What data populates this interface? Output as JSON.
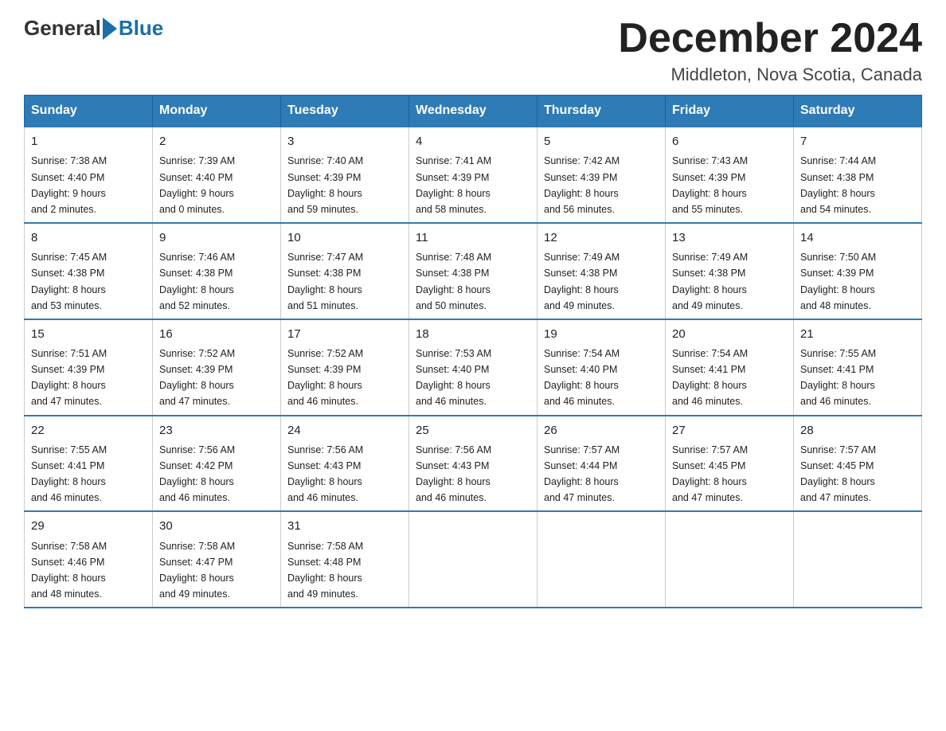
{
  "logo": {
    "general": "General",
    "blue": "Blue"
  },
  "title": "December 2024",
  "location": "Middleton, Nova Scotia, Canada",
  "days_of_week": [
    "Sunday",
    "Monday",
    "Tuesday",
    "Wednesday",
    "Thursday",
    "Friday",
    "Saturday"
  ],
  "weeks": [
    [
      {
        "day": "1",
        "sunrise": "7:38 AM",
        "sunset": "4:40 PM",
        "daylight": "9 hours and 2 minutes."
      },
      {
        "day": "2",
        "sunrise": "7:39 AM",
        "sunset": "4:40 PM",
        "daylight": "9 hours and 0 minutes."
      },
      {
        "day": "3",
        "sunrise": "7:40 AM",
        "sunset": "4:39 PM",
        "daylight": "8 hours and 59 minutes."
      },
      {
        "day": "4",
        "sunrise": "7:41 AM",
        "sunset": "4:39 PM",
        "daylight": "8 hours and 58 minutes."
      },
      {
        "day": "5",
        "sunrise": "7:42 AM",
        "sunset": "4:39 PM",
        "daylight": "8 hours and 56 minutes."
      },
      {
        "day": "6",
        "sunrise": "7:43 AM",
        "sunset": "4:39 PM",
        "daylight": "8 hours and 55 minutes."
      },
      {
        "day": "7",
        "sunrise": "7:44 AM",
        "sunset": "4:38 PM",
        "daylight": "8 hours and 54 minutes."
      }
    ],
    [
      {
        "day": "8",
        "sunrise": "7:45 AM",
        "sunset": "4:38 PM",
        "daylight": "8 hours and 53 minutes."
      },
      {
        "day": "9",
        "sunrise": "7:46 AM",
        "sunset": "4:38 PM",
        "daylight": "8 hours and 52 minutes."
      },
      {
        "day": "10",
        "sunrise": "7:47 AM",
        "sunset": "4:38 PM",
        "daylight": "8 hours and 51 minutes."
      },
      {
        "day": "11",
        "sunrise": "7:48 AM",
        "sunset": "4:38 PM",
        "daylight": "8 hours and 50 minutes."
      },
      {
        "day": "12",
        "sunrise": "7:49 AM",
        "sunset": "4:38 PM",
        "daylight": "8 hours and 49 minutes."
      },
      {
        "day": "13",
        "sunrise": "7:49 AM",
        "sunset": "4:38 PM",
        "daylight": "8 hours and 49 minutes."
      },
      {
        "day": "14",
        "sunrise": "7:50 AM",
        "sunset": "4:39 PM",
        "daylight": "8 hours and 48 minutes."
      }
    ],
    [
      {
        "day": "15",
        "sunrise": "7:51 AM",
        "sunset": "4:39 PM",
        "daylight": "8 hours and 47 minutes."
      },
      {
        "day": "16",
        "sunrise": "7:52 AM",
        "sunset": "4:39 PM",
        "daylight": "8 hours and 47 minutes."
      },
      {
        "day": "17",
        "sunrise": "7:52 AM",
        "sunset": "4:39 PM",
        "daylight": "8 hours and 46 minutes."
      },
      {
        "day": "18",
        "sunrise": "7:53 AM",
        "sunset": "4:40 PM",
        "daylight": "8 hours and 46 minutes."
      },
      {
        "day": "19",
        "sunrise": "7:54 AM",
        "sunset": "4:40 PM",
        "daylight": "8 hours and 46 minutes."
      },
      {
        "day": "20",
        "sunrise": "7:54 AM",
        "sunset": "4:41 PM",
        "daylight": "8 hours and 46 minutes."
      },
      {
        "day": "21",
        "sunrise": "7:55 AM",
        "sunset": "4:41 PM",
        "daylight": "8 hours and 46 minutes."
      }
    ],
    [
      {
        "day": "22",
        "sunrise": "7:55 AM",
        "sunset": "4:41 PM",
        "daylight": "8 hours and 46 minutes."
      },
      {
        "day": "23",
        "sunrise": "7:56 AM",
        "sunset": "4:42 PM",
        "daylight": "8 hours and 46 minutes."
      },
      {
        "day": "24",
        "sunrise": "7:56 AM",
        "sunset": "4:43 PM",
        "daylight": "8 hours and 46 minutes."
      },
      {
        "day": "25",
        "sunrise": "7:56 AM",
        "sunset": "4:43 PM",
        "daylight": "8 hours and 46 minutes."
      },
      {
        "day": "26",
        "sunrise": "7:57 AM",
        "sunset": "4:44 PM",
        "daylight": "8 hours and 47 minutes."
      },
      {
        "day": "27",
        "sunrise": "7:57 AM",
        "sunset": "4:45 PM",
        "daylight": "8 hours and 47 minutes."
      },
      {
        "day": "28",
        "sunrise": "7:57 AM",
        "sunset": "4:45 PM",
        "daylight": "8 hours and 47 minutes."
      }
    ],
    [
      {
        "day": "29",
        "sunrise": "7:58 AM",
        "sunset": "4:46 PM",
        "daylight": "8 hours and 48 minutes."
      },
      {
        "day": "30",
        "sunrise": "7:58 AM",
        "sunset": "4:47 PM",
        "daylight": "8 hours and 49 minutes."
      },
      {
        "day": "31",
        "sunrise": "7:58 AM",
        "sunset": "4:48 PM",
        "daylight": "8 hours and 49 minutes."
      },
      null,
      null,
      null,
      null
    ]
  ],
  "labels": {
    "sunrise": "Sunrise:",
    "sunset": "Sunset:",
    "daylight": "Daylight:"
  }
}
